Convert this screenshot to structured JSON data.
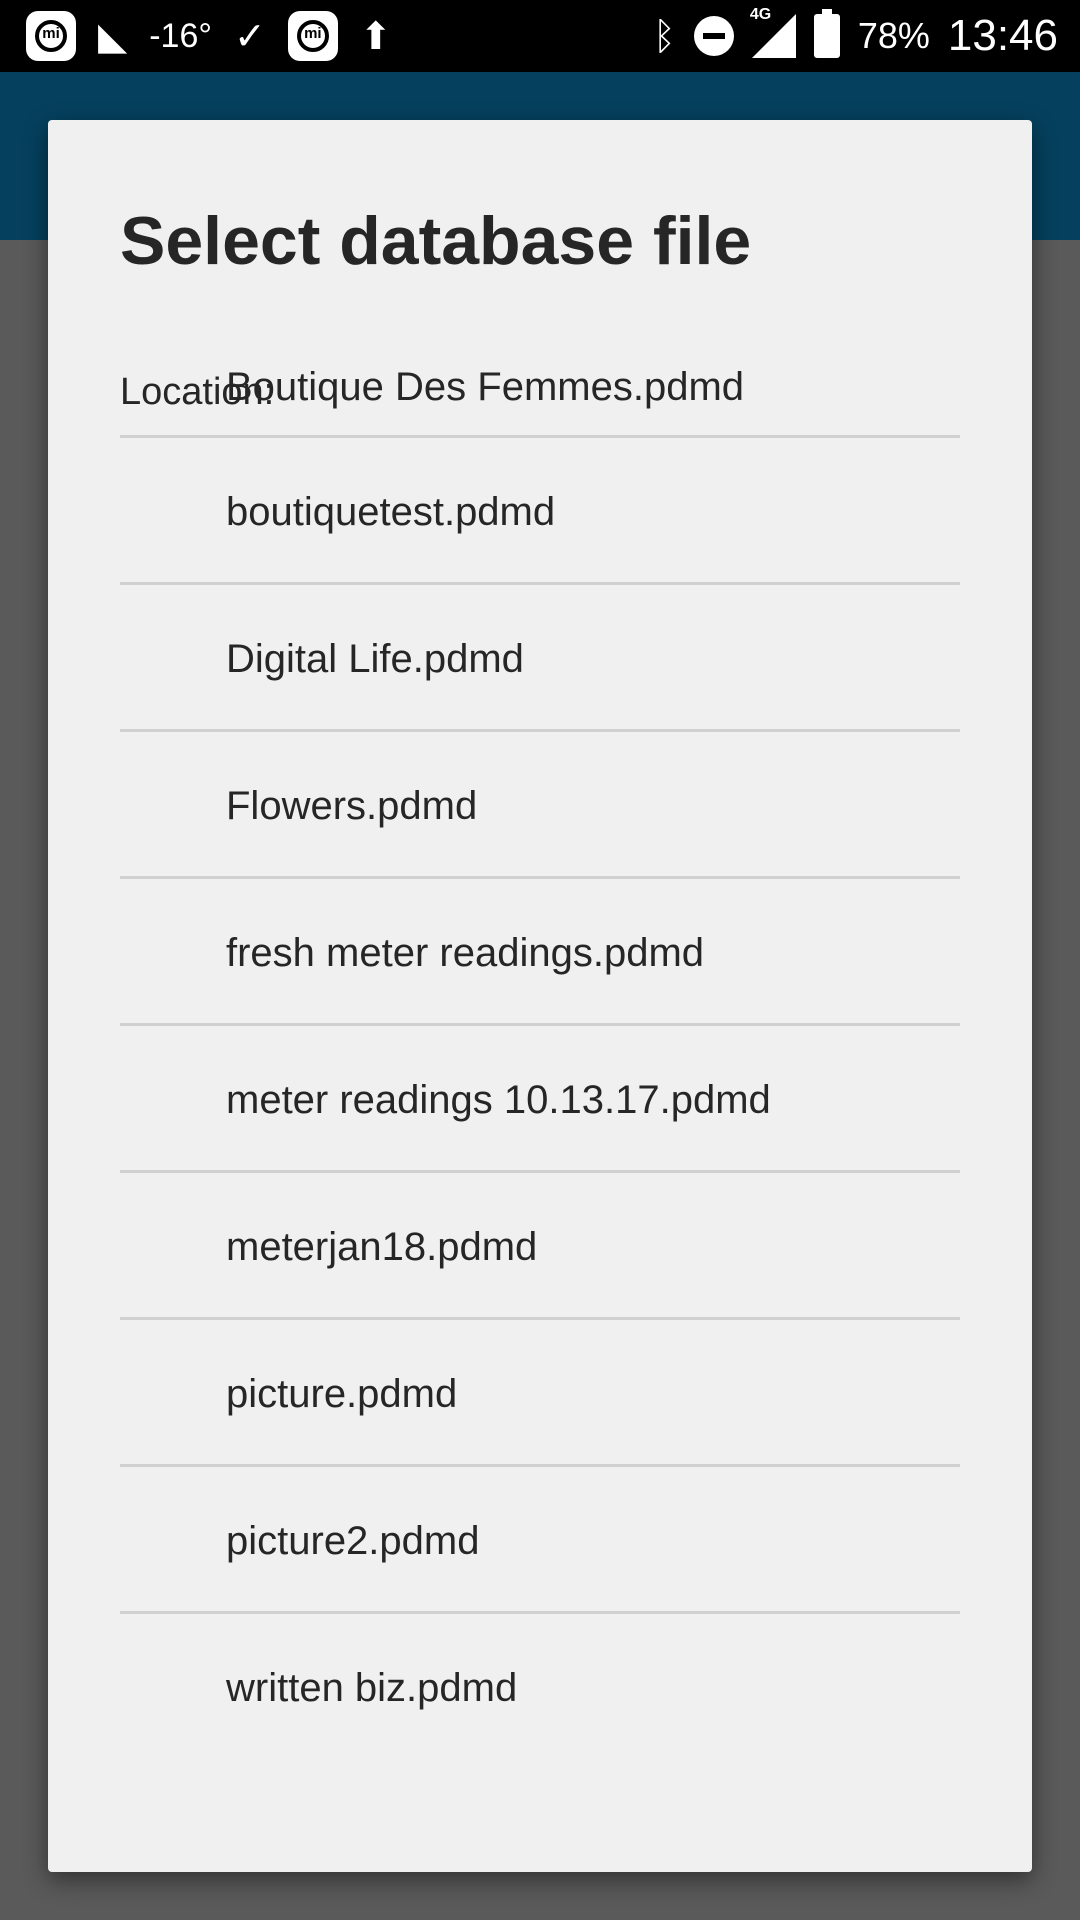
{
  "status_bar": {
    "temperature": "-16°",
    "network": "4G",
    "battery": "78%",
    "time": "13:46",
    "icons": [
      "mi-icon",
      "n-icon",
      "download-done-icon",
      "mi-icon",
      "rocket-icon",
      "bluetooth-icon",
      "do-not-disturb-icon",
      "signal-icon",
      "battery-charging-icon"
    ]
  },
  "dialog": {
    "title": "Select database file",
    "location_label": "Location:",
    "files": [
      "Boutique Des Femmes.pdmd",
      "boutiquetest.pdmd",
      "Digital Life.pdmd",
      "Flowers.pdmd",
      "fresh meter readings.pdmd",
      "meter readings 10.13.17.pdmd",
      "meterjan18.pdmd",
      "picture.pdmd",
      "picture2.pdmd",
      "written biz.pdmd"
    ]
  }
}
